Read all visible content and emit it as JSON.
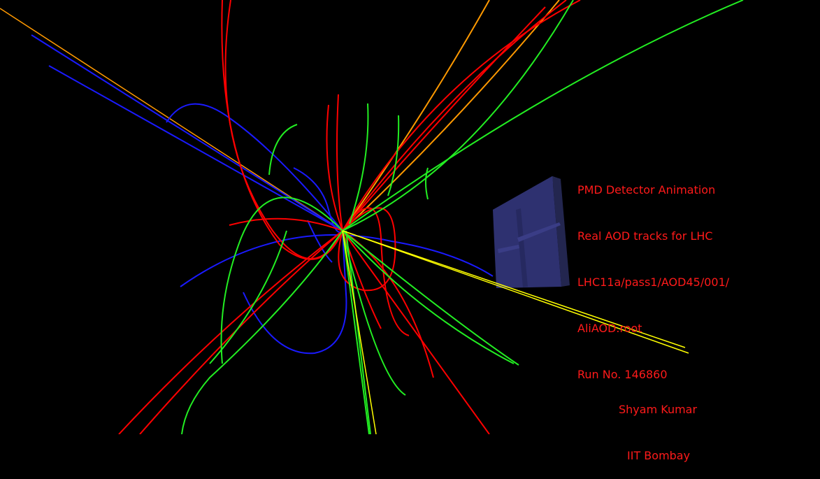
{
  "info": {
    "line1": "PMD Detector Animation",
    "line2": "Real AOD tracks for LHC",
    "line3": "LHC11a/pass1/AOD45/001/",
    "line4": "AliAOD.root",
    "line5": "Run No. 146860"
  },
  "credit": {
    "name": "Shyam Kumar",
    "institute": "IIT Bombay"
  },
  "colors": {
    "background": "#000000",
    "text": "#ff1a1a",
    "track_red": "#ff0000",
    "track_green": "#22ee22",
    "track_blue": "#1a1aff",
    "track_orange": "#ff9900",
    "track_yellow": "#ffff00",
    "detector": "#2e3170"
  }
}
